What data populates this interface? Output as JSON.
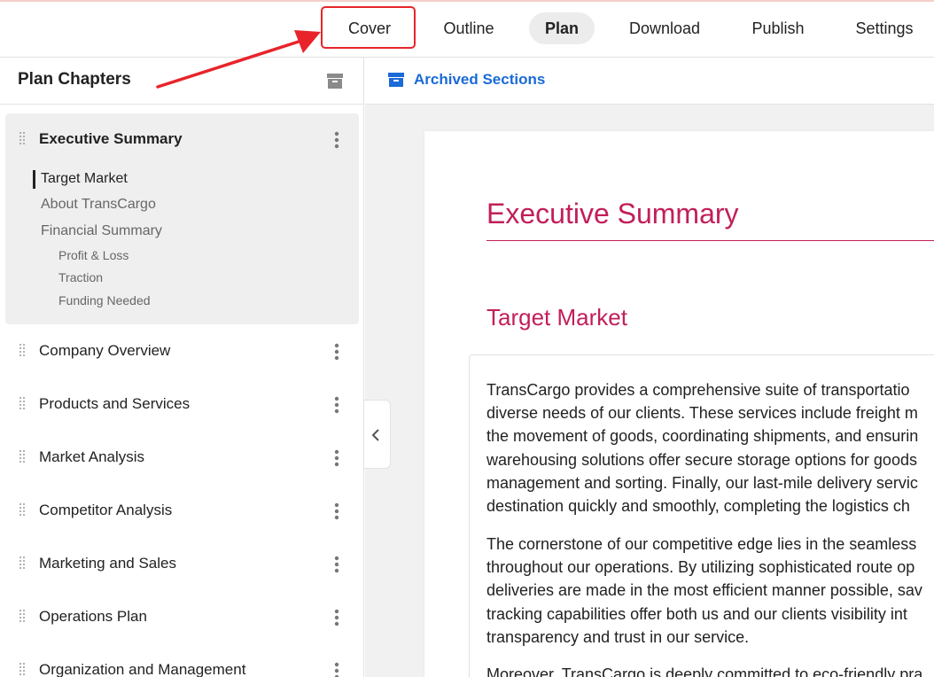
{
  "nav": {
    "items": [
      {
        "label": "Cover"
      },
      {
        "label": "Outline"
      },
      {
        "label": "Plan"
      },
      {
        "label": "Download"
      },
      {
        "label": "Publish"
      },
      {
        "label": "Settings"
      }
    ],
    "active": "Plan",
    "highlighted": "Cover"
  },
  "sidebar": {
    "title": "Plan Chapters",
    "active_chapter": {
      "label": "Executive Summary",
      "sections": [
        {
          "label": "Target Market"
        },
        {
          "label": "About TransCargo"
        },
        {
          "label": "Financial Summary"
        }
      ],
      "subsections": [
        {
          "label": "Profit & Loss"
        },
        {
          "label": "Traction"
        },
        {
          "label": "Funding Needed"
        }
      ]
    },
    "chapters": [
      {
        "label": "Company Overview"
      },
      {
        "label": "Products and Services"
      },
      {
        "label": "Market Analysis"
      },
      {
        "label": "Competitor Analysis"
      },
      {
        "label": "Marketing and Sales"
      },
      {
        "label": "Operations Plan"
      },
      {
        "label": "Organization and Management"
      }
    ]
  },
  "main": {
    "archived_link": "Archived Sections",
    "doc_title": "Executive Summary",
    "section_title": "Target Market",
    "paragraph1": [
      "TransCargo provides a comprehensive suite of transportatio",
      "diverse needs of our clients. These services include freight m",
      "the movement of goods, coordinating shipments, and ensurin",
      "warehousing solutions offer secure storage options for goods",
      "management and sorting. Finally, our last-mile delivery servic",
      "destination quickly and smoothly, completing the logistics ch"
    ],
    "paragraph2": [
      "The cornerstone of our competitive edge lies in the seamless",
      "throughout our operations. By utilizing sophisticated route op",
      "deliveries are made in the most efficient manner possible, sav",
      "tracking capabilities offer both us and our clients visibility int",
      "transparency and trust in our service."
    ],
    "paragraph3": [
      "Moreover, TransCargo is deeply committed to eco-friendly pra"
    ]
  },
  "colors": {
    "accent": "#c21f5a",
    "link": "#1a6ad8",
    "annotation": "#e8242a"
  },
  "icons": [
    "archive-icon",
    "drag-handle-icon",
    "more-vertical-icon",
    "chevron-left-icon"
  ]
}
